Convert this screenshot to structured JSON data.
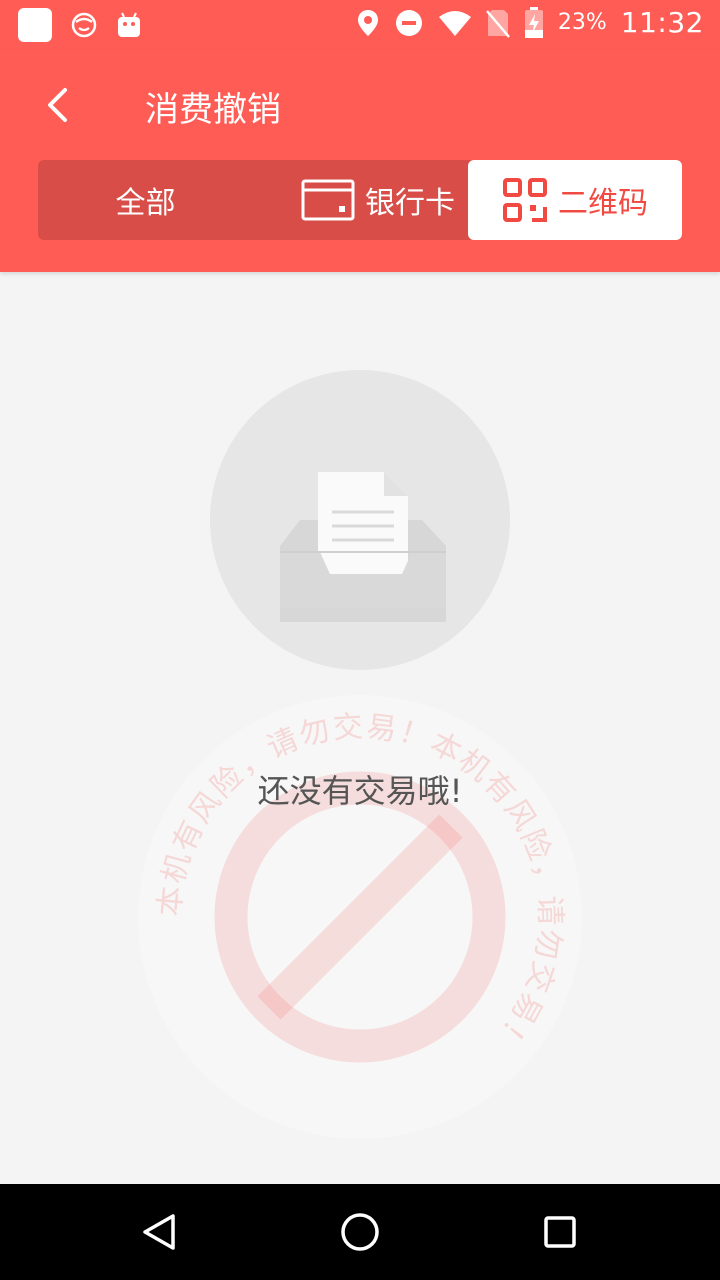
{
  "status_bar": {
    "battery": "23%",
    "time": "11:32",
    "icons": [
      "app-square-icon",
      "face-icon",
      "android-icon",
      "location-icon",
      "dnd-icon",
      "wifi-icon",
      "no-sim-icon",
      "battery-charging-icon"
    ]
  },
  "header": {
    "title": "消费撤销",
    "back_icon": "chevron-left-icon"
  },
  "tabs": [
    {
      "label": "全部",
      "selected": false
    },
    {
      "label": "银行卡",
      "icon": "card-icon",
      "selected": false
    },
    {
      "label": "二维码",
      "icon": "qr-code-icon",
      "selected": true
    }
  ],
  "empty_state": {
    "message": "还没有交易哦!",
    "icon": "empty-inbox-icon"
  },
  "watermark": {
    "text": "本机有风险，请勿交易！本机有风险，请勿交易！",
    "icon": "prohibited-icon"
  },
  "colors": {
    "accent": "#ff5c56",
    "tab_track": "#d84d47",
    "selected_tab_text": "#f04a43",
    "background": "#f4f4f4"
  },
  "navigation_bar": [
    "back-triangle-icon",
    "home-circle-icon",
    "recents-square-icon"
  ]
}
